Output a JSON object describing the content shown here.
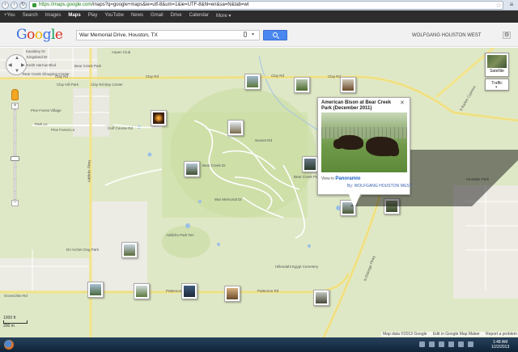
{
  "browser": {
    "url_host": "https://maps.google.com",
    "url_path": "/maps?q=google+maps&ie=utf-8&um=1&ie=UTF-8&hl=en&sa=N&tab=wl"
  },
  "google_bar": {
    "items": [
      "+You",
      "Search",
      "Images",
      "Maps",
      "Play",
      "YouTube",
      "News",
      "Gmail",
      "Drive",
      "Calendar",
      "More ▾"
    ],
    "active_index": 3
  },
  "header": {
    "logo_letters": [
      "G",
      "o",
      "o",
      "g",
      "l",
      "e"
    ],
    "search_value": "War Memorial Drive, Houston, TX",
    "user_name": "WOLFGANG HOUSTON WEST",
    "settings_glyph": "⚙"
  },
  "map": {
    "labels": [
      "Kasskley Dr",
      "Keith Harrow Blvd",
      "Kingsland Dr",
      "Bear Creek Park",
      "Bear Creek Shopping Center",
      "Aspen Club",
      "Clay Rd",
      "Clay Rd",
      "Clay Rd",
      "Clay Rd",
      "Clay Hill Park",
      "Clay Rd Bay Center",
      "Pine Forest Village",
      "Park Ln",
      "Pine Forest Ln",
      "Golf Course Rd",
      "Bear Creek Pioneers Park",
      "Addicks Park Ten",
      "Dri Archer Dog Park",
      "Groeschke Rd",
      "Patterson Rd",
      "Patterson Rd",
      "Hillendahl Egypt Cemetery",
      "N Eldridge Pkwy",
      "S Barker Cypress",
      "Hinsdale Park",
      "Addicks Pkwy",
      "War Memorial Dr",
      "Sunset Rd",
      "Bear Creek Dr"
    ],
    "scale": {
      "feet": "1000 ft",
      "meters": "200 m"
    },
    "attribution": [
      "Map data ©2013 Google",
      "Edit in Google Map Maker",
      "Report a problem"
    ]
  },
  "controls": {
    "pan_arrows": [
      "▲",
      "◀",
      "▶",
      "▼"
    ],
    "zoom_in": "+",
    "zoom_out": "−",
    "satellite_label": "Satellite",
    "traffic_label": "Traffic",
    "traffic_arrow": "▾"
  },
  "info_window": {
    "close_glyph": "✕",
    "title": "American Bison at Bear Creek Park (December 2011)",
    "view_in_prefix": "View in",
    "view_in_brand": "Panoramio",
    "byline": "By: WOLFGANG HOUSTON WEST"
  },
  "taskbar": {
    "time": "1:48 AM",
    "date": "1/22/2013"
  }
}
